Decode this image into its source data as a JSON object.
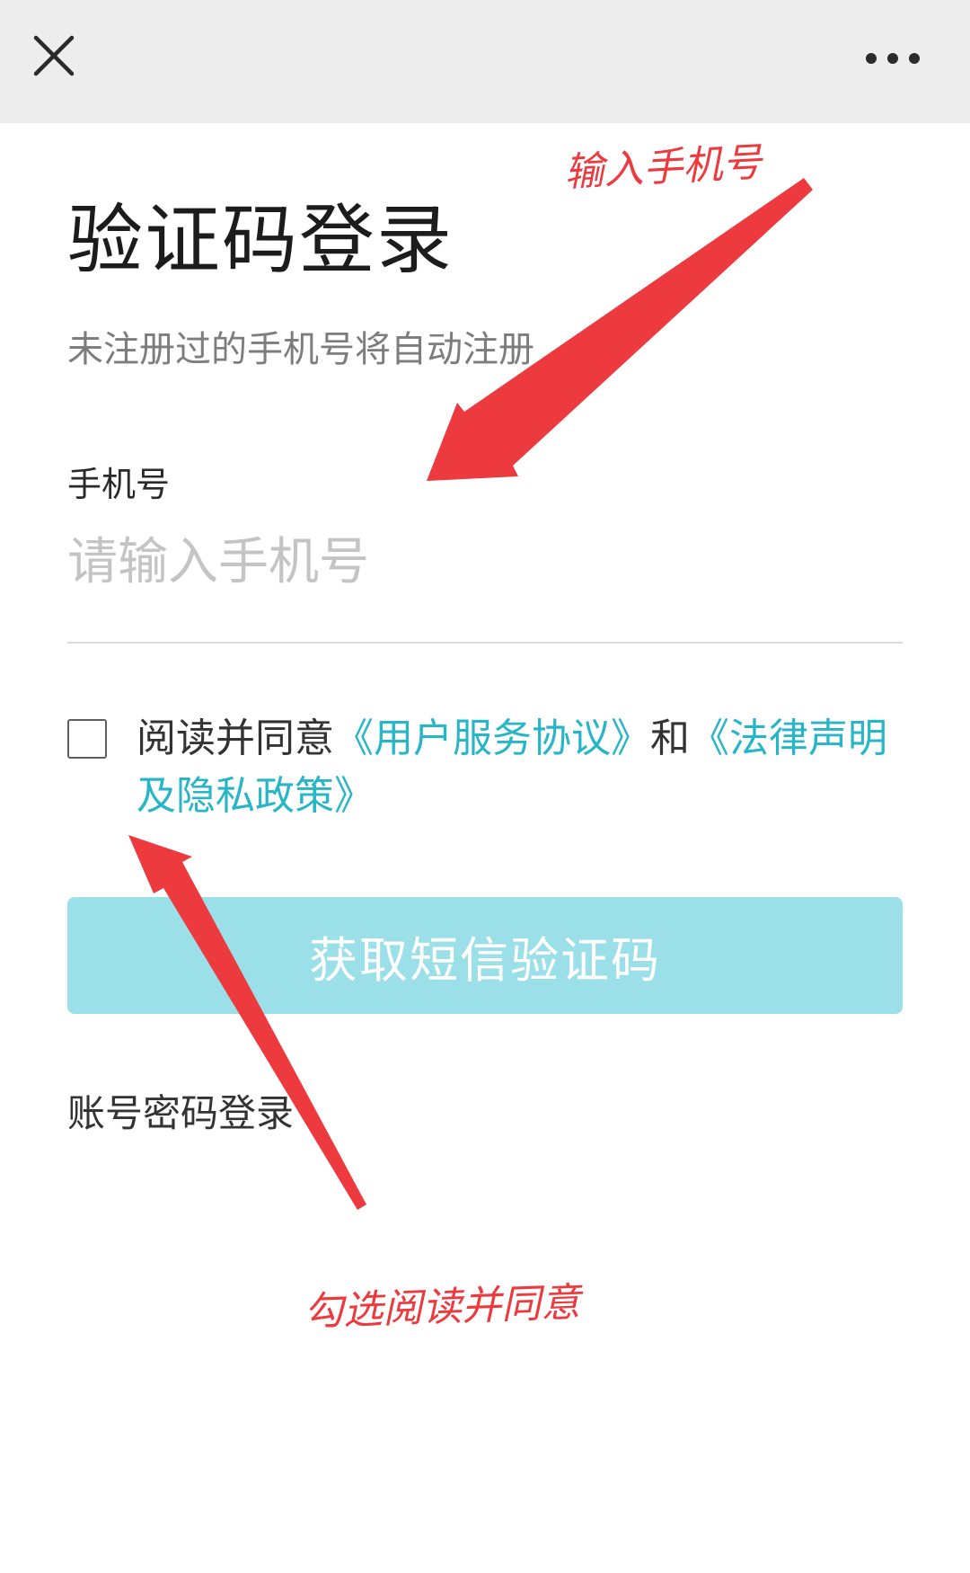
{
  "nav": {
    "close_icon": "close-icon",
    "more_icon": "more-icon"
  },
  "login": {
    "title": "验证码登录",
    "subtitle": "未注册过的手机号将自动注册",
    "phone_label": "手机号",
    "phone_value": "",
    "phone_placeholder": "请输入手机号",
    "agree_prefix": "阅读并同意",
    "agree_link_service": "《用户服务协议》",
    "agree_and": "和",
    "agree_link_privacy": "《法律声明及隐私政策》",
    "agree_checked": false,
    "sms_button": "获取短信验证码",
    "password_login": "账号密码登录"
  },
  "annotations": {
    "phone_note": "输入手机号",
    "check_note": "勾选阅读并同意"
  },
  "colors": {
    "accent": "#27b6c8",
    "button_bg": "#9bdfe8",
    "annotation": "#ec3a3f",
    "topbar": "#ededed"
  }
}
